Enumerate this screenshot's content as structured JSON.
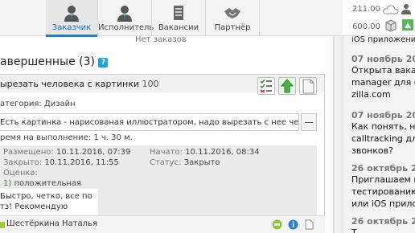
{
  "nav": {
    "items": [
      {
        "label": "Заказчик",
        "icon": "customer-icon",
        "active": true
      },
      {
        "label": "Исполнитель",
        "icon": "performer-icon",
        "active": false
      },
      {
        "label": "Вакансии",
        "icon": "vacancies-icon",
        "active": false
      },
      {
        "label": "Партнёр",
        "icon": "handshake-icon",
        "active": false
      }
    ]
  },
  "stats": {
    "cloud_value": "211.00",
    "box_value": "600.00"
  },
  "no_orders": "Нет заказов",
  "section": {
    "title": "авершенные (3)",
    "help": "?"
  },
  "order": {
    "title": "ырезать человека с картинки",
    "price": "100",
    "category_label": "атегория:",
    "category_value": "Дизайн",
    "description": "Есть картинка - нарисованая иллюстратором, надо вырезать с нее человека.",
    "time_label": "ремя на выполнение:",
    "time_value": "1 ч. 30 м.",
    "placed_label": "Размещено:",
    "placed_value": "10.11.2016, 07:39",
    "closed_label": "Закрыто:",
    "closed_value": "10.11.2016, 11:55",
    "started_label": "Начато:",
    "started_value": "10.11.2016, 08:34",
    "status_label": "Статус:",
    "status_value": "Закрыто",
    "rating_label": "Оценка:",
    "rating_num": "1)",
    "rating_text": "положительная",
    "review_line1": "Быстро, четко, все по",
    "review_line2": "тз! Рекомендую",
    "user": "Шестёркина Наталья"
  },
  "sidebar": {
    "top_text": "iOS приложени",
    "news": [
      {
        "date": "07 ноябрь 20",
        "lines": [
          "Открыта ваканс",
          "manager для се",
          "zilla.com"
        ]
      },
      {
        "date": "07 ноябрь 20",
        "lines": [
          "Как понять, ну",
          "calltracking для",
          "звонков?"
        ]
      },
      {
        "date": "26 октябрь 20",
        "lines": [
          "Приглашаем по",
          "тестированию",
          "или iOS прилож"
        ]
      },
      {
        "date": "26 октябрь 20",
        "lines": [
          "Т"
        ]
      }
    ]
  },
  "colors": {
    "accent": "#1a7fd0",
    "help": "#2a9fd8",
    "user_marker": "#a8c93c"
  }
}
